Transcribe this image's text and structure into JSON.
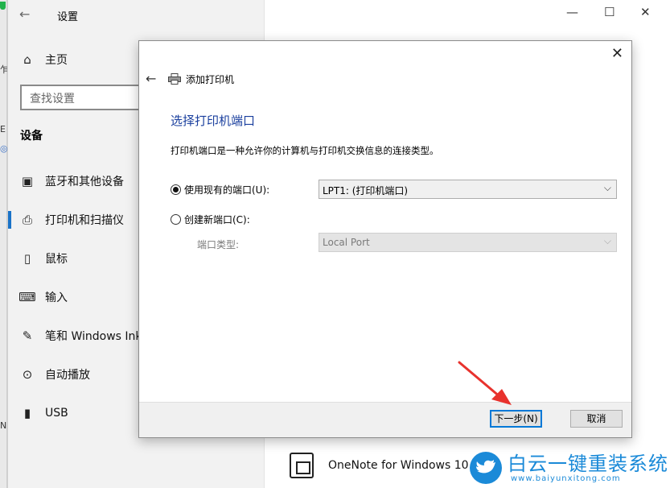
{
  "background_window": {
    "chars": [
      "乍",
      "E",
      "◎",
      "N"
    ]
  },
  "settings": {
    "title": "设置",
    "search_placeholder": "查找设置",
    "section_title": "设备",
    "nav": [
      {
        "label": "主页",
        "icon": "home-icon"
      },
      {
        "label": "蓝牙和其他设备",
        "icon": "bluetooth-devices-icon"
      },
      {
        "label": "打印机和扫描仪",
        "icon": "printer-icon"
      },
      {
        "label": "鼠标",
        "icon": "mouse-icon"
      },
      {
        "label": "输入",
        "icon": "keyboard-icon"
      },
      {
        "label": "笔和 Windows Ink",
        "icon": "pen-icon"
      },
      {
        "label": "自动播放",
        "icon": "autoplay-icon"
      },
      {
        "label": "USB",
        "icon": "usb-icon"
      }
    ],
    "active_index": 2,
    "right_item": "OneNote for Windows 10"
  },
  "dialog": {
    "title": "添加打印机",
    "heading": "选择打印机端口",
    "description": "打印机端口是一种允许你的计算机与打印机交换信息的连接类型。",
    "option_existing": "使用现有的端口(U):",
    "existing_value": "LPT1: (打印机端口)",
    "option_new": "创建新端口(C):",
    "port_type_label": "端口类型:",
    "port_type_value": "Local Port",
    "next_button": "下一步(N)",
    "cancel_button": "取消"
  },
  "watermark": {
    "main": "白云一键重装系统",
    "sub": "www.baiyunxitong.com"
  },
  "colors": {
    "accent": "#1a73c8",
    "heading": "#1a3f9e",
    "arrow": "#e8322d",
    "watermark": "#1b8ad8"
  }
}
